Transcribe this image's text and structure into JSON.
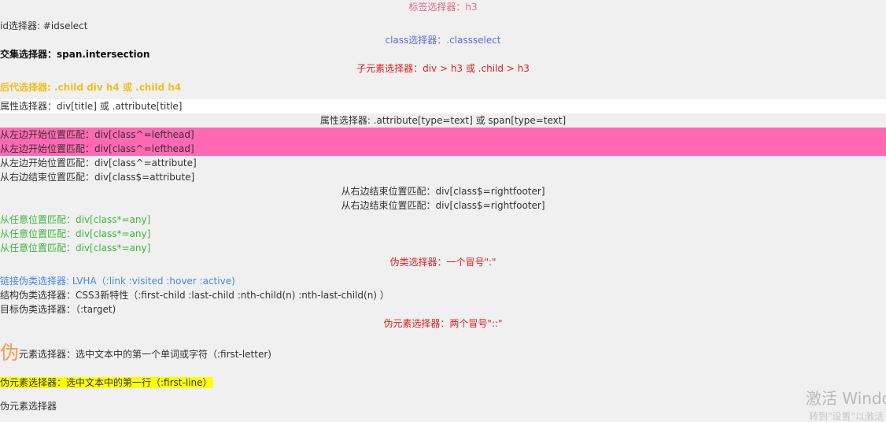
{
  "lines": {
    "tag_selector": "标签选择器：h3",
    "id_selector": "id选择器: #idselect",
    "class_selector": "class选择器：.classselect",
    "intersection_selector": "交集选择器：span.intersection",
    "child_selector": "子元素选择器：div > h3 或 .child > h3",
    "descendant_selector": "后代选择器: .child div h4 或 .child h4",
    "attribute_selector_1": "属性选择器：div[title] 或 .attribute[title]",
    "attribute_selector_2": "属性选择器: .attribute[type=text] 或 span[type=text]",
    "starts_with_1": "从左边开始位置匹配：div[class^=lefthead]",
    "starts_with_2": "从左边开始位置匹配：div[class^=lefthead]",
    "starts_with_3": "从左边开始位置匹配：div[class^=attribute]",
    "ends_with_left": "从右边结束位置匹配：div[class$=attribute]",
    "ends_with_right_1": "从右边结束位置匹配：div[class$=rightfooter]",
    "ends_with_right_2": "从右边结束位置匹配：div[class$=rightfooter]",
    "contains_1": "从任意位置匹配：div[class*=any]",
    "contains_2": "从任意位置匹配：div[class*=any]",
    "contains_3": "从任意位置匹配：div[class*=any]",
    "pseudo_class": "伪类选择器：一个冒号\":\"",
    "link_pseudo": "链接伪类选择器: LVHA（:link :visited :hover :active)",
    "structural_pseudo": "结构伪类选择器：CSS3新特性（:first-child :last-child :nth-child(n) :nth-last-child(n) ）",
    "target_pseudo": "目标伪类选择器：（:target)",
    "pseudo_element": "伪元素选择器：两个冒号\"::\"",
    "first_letter_big": "伪",
    "first_letter_rest": "元素选择器：选中文本中的第一个单词或字符（:first-letter)",
    "first_line": "伪元素选择器：选中文本中的第一行（:first-line）",
    "last_line": "伪元素选择器"
  },
  "watermark": {
    "title": "激活 Windo",
    "subtitle": "转到\"设置\"以激活"
  },
  "colors": {
    "page_background": "#f0f0f0",
    "tag_selector": "#e06c8c",
    "class_selector": "#5a6fd6",
    "child_selector": "#e02020",
    "descendant_selector": "#f0c020",
    "pink_band": "#ff69b4",
    "contains": "#3cb83c",
    "pseudo_class": "#e02020",
    "link_pseudo": "#4a88e0",
    "first_letter": "#f29b4b",
    "first_line_highlight": "#ffff00"
  }
}
